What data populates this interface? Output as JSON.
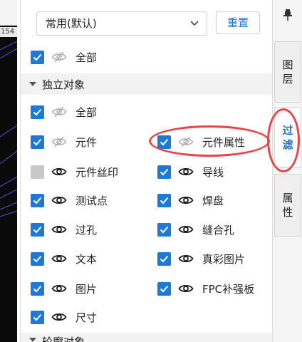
{
  "ruler": {
    "number": "154"
  },
  "toolbar": {
    "preset_value": "常用(默认)",
    "reset_label": "重置"
  },
  "top_all": {
    "label": "全部",
    "checked": true,
    "visible": false
  },
  "sections": [
    {
      "label": "独立对象",
      "expanded": true
    },
    {
      "label": "轮廓对象",
      "expanded": false
    }
  ],
  "independent": {
    "all": {
      "label": "全部",
      "checked": true,
      "visible": false
    },
    "items": [
      {
        "label": "元件",
        "checked": true,
        "visible": false
      },
      {
        "label": "元件属性",
        "checked": true,
        "visible": false
      },
      {
        "label": "元件丝印",
        "checked": false,
        "visible": true
      },
      {
        "label": "导线",
        "checked": true,
        "visible": true
      },
      {
        "label": "测试点",
        "checked": true,
        "visible": true
      },
      {
        "label": "焊盘",
        "checked": true,
        "visible": true
      },
      {
        "label": "过孔",
        "checked": true,
        "visible": true
      },
      {
        "label": "缝合孔",
        "checked": true,
        "visible": true
      },
      {
        "label": "文本",
        "checked": true,
        "visible": true
      },
      {
        "label": "真彩图片",
        "checked": true,
        "visible": true
      },
      {
        "label": "图片",
        "checked": true,
        "visible": true
      },
      {
        "label": "FPC补强板",
        "checked": true,
        "visible": true
      },
      {
        "label": "尺寸",
        "checked": true,
        "visible": true
      }
    ]
  },
  "tabs": [
    {
      "chars": [
        "图",
        "层"
      ],
      "active": false
    },
    {
      "chars": [
        "过",
        "滤"
      ],
      "active": true
    },
    {
      "chars": [
        "属",
        "性"
      ],
      "active": false
    }
  ],
  "colors": {
    "accent": "#1f74c9",
    "checkbox": "#1e78d6",
    "highlight": "#e8454a",
    "canvas": "#0a0a0a"
  },
  "icons": {
    "visible": "eye-icon",
    "hidden": "eye-slash-icon",
    "pin": "pin-icon",
    "dropdown": "chevron-down-icon"
  }
}
